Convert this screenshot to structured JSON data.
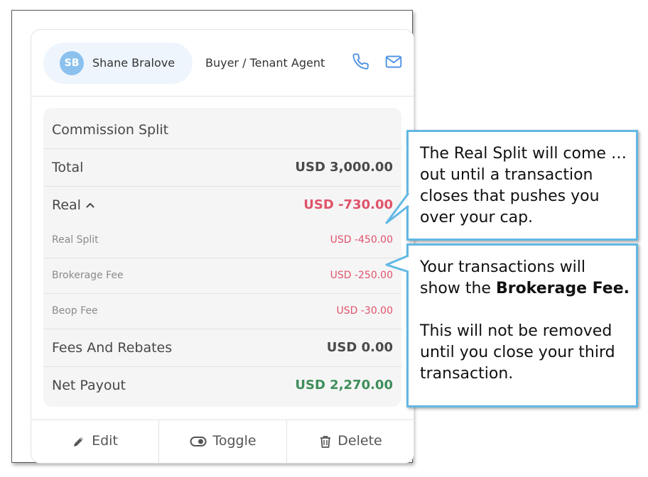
{
  "agent": {
    "initials": "SB",
    "name": "Shane Bralove",
    "role": "Buyer / Tenant Agent"
  },
  "commission": {
    "heading": "Commission Split",
    "total": {
      "label": "Total",
      "value": "USD 3,000.00"
    },
    "real": {
      "label": "Real",
      "value": "USD -730.00",
      "items": [
        {
          "label": "Real Split",
          "value": "USD -450.00"
        },
        {
          "label": "Brokerage Fee",
          "value": "USD -250.00"
        },
        {
          "label": "Beop Fee",
          "value": "USD -30.00"
        }
      ]
    },
    "fees": {
      "label": "Fees And Rebates",
      "value": "USD 0.00"
    },
    "net": {
      "label": "Net Payout",
      "value": "USD 2,270.00"
    }
  },
  "actions": {
    "edit": "Edit",
    "toggle": "Toggle",
    "delete": "Delete"
  },
  "callouts": {
    "first": "The Real Split will come …out until a transaction closes that pushes you over your cap.",
    "second_pre": "Your transactions will show the ",
    "second_bold": "Brokerage Fee.",
    "second_post": "This will not be removed until you close your third transaction."
  },
  "icons": {
    "phone": "phone-icon",
    "mail": "mail-icon",
    "chevron": "chevron-up-icon",
    "edit": "pencil-icon",
    "toggle": "toggle-icon",
    "delete": "trash-icon"
  },
  "colors": {
    "accent": "#4a90e2",
    "negative": "#e0536a",
    "positive": "#3e8e5a",
    "callout_border": "#62b8e4"
  }
}
